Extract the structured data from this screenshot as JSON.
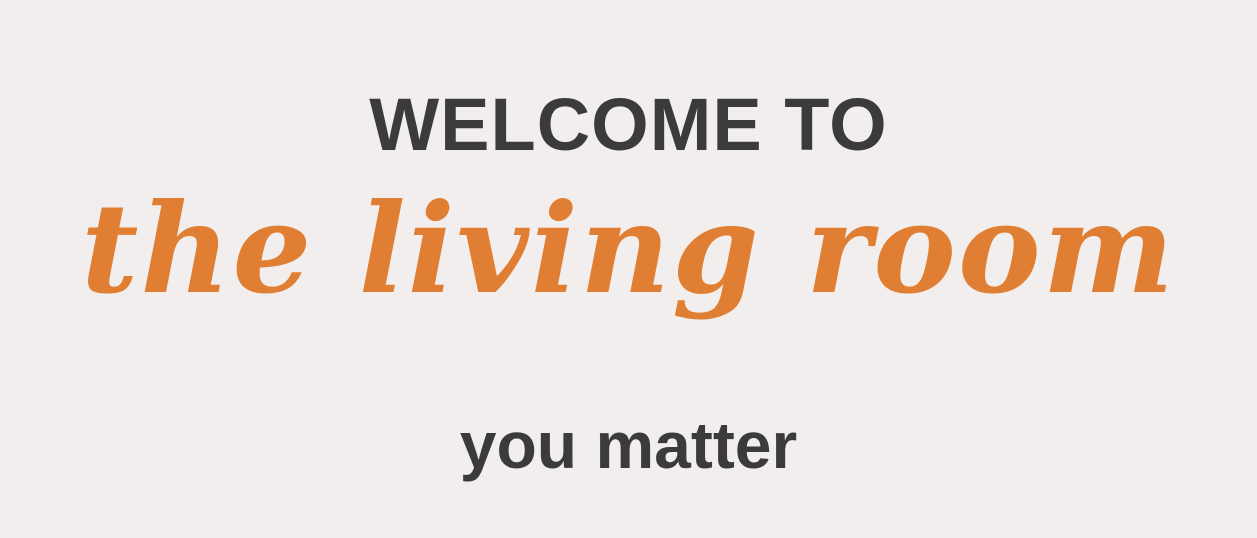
{
  "banner": {
    "welcome_text": "WELCOME TO",
    "brand_name": "the living room",
    "tagline": "you matter"
  },
  "colors": {
    "background": "#f2eeed",
    "text_dark": "#3b3b3b",
    "brand_orange": "#e07f33"
  }
}
